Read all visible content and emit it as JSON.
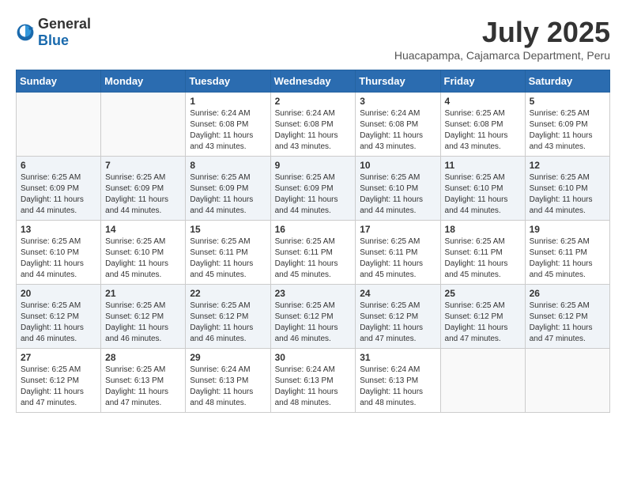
{
  "logo": {
    "general": "General",
    "blue": "Blue"
  },
  "title": {
    "month_year": "July 2025",
    "location": "Huacapampa, Cajamarca Department, Peru"
  },
  "weekdays": [
    "Sunday",
    "Monday",
    "Tuesday",
    "Wednesday",
    "Thursday",
    "Friday",
    "Saturday"
  ],
  "weeks": [
    [
      {
        "day": "",
        "info": ""
      },
      {
        "day": "",
        "info": ""
      },
      {
        "day": "1",
        "info": "Sunrise: 6:24 AM\nSunset: 6:08 PM\nDaylight: 11 hours and 43 minutes."
      },
      {
        "day": "2",
        "info": "Sunrise: 6:24 AM\nSunset: 6:08 PM\nDaylight: 11 hours and 43 minutes."
      },
      {
        "day": "3",
        "info": "Sunrise: 6:24 AM\nSunset: 6:08 PM\nDaylight: 11 hours and 43 minutes."
      },
      {
        "day": "4",
        "info": "Sunrise: 6:25 AM\nSunset: 6:08 PM\nDaylight: 11 hours and 43 minutes."
      },
      {
        "day": "5",
        "info": "Sunrise: 6:25 AM\nSunset: 6:09 PM\nDaylight: 11 hours and 43 minutes."
      }
    ],
    [
      {
        "day": "6",
        "info": "Sunrise: 6:25 AM\nSunset: 6:09 PM\nDaylight: 11 hours and 44 minutes."
      },
      {
        "day": "7",
        "info": "Sunrise: 6:25 AM\nSunset: 6:09 PM\nDaylight: 11 hours and 44 minutes."
      },
      {
        "day": "8",
        "info": "Sunrise: 6:25 AM\nSunset: 6:09 PM\nDaylight: 11 hours and 44 minutes."
      },
      {
        "day": "9",
        "info": "Sunrise: 6:25 AM\nSunset: 6:09 PM\nDaylight: 11 hours and 44 minutes."
      },
      {
        "day": "10",
        "info": "Sunrise: 6:25 AM\nSunset: 6:10 PM\nDaylight: 11 hours and 44 minutes."
      },
      {
        "day": "11",
        "info": "Sunrise: 6:25 AM\nSunset: 6:10 PM\nDaylight: 11 hours and 44 minutes."
      },
      {
        "day": "12",
        "info": "Sunrise: 6:25 AM\nSunset: 6:10 PM\nDaylight: 11 hours and 44 minutes."
      }
    ],
    [
      {
        "day": "13",
        "info": "Sunrise: 6:25 AM\nSunset: 6:10 PM\nDaylight: 11 hours and 44 minutes."
      },
      {
        "day": "14",
        "info": "Sunrise: 6:25 AM\nSunset: 6:10 PM\nDaylight: 11 hours and 45 minutes."
      },
      {
        "day": "15",
        "info": "Sunrise: 6:25 AM\nSunset: 6:11 PM\nDaylight: 11 hours and 45 minutes."
      },
      {
        "day": "16",
        "info": "Sunrise: 6:25 AM\nSunset: 6:11 PM\nDaylight: 11 hours and 45 minutes."
      },
      {
        "day": "17",
        "info": "Sunrise: 6:25 AM\nSunset: 6:11 PM\nDaylight: 11 hours and 45 minutes."
      },
      {
        "day": "18",
        "info": "Sunrise: 6:25 AM\nSunset: 6:11 PM\nDaylight: 11 hours and 45 minutes."
      },
      {
        "day": "19",
        "info": "Sunrise: 6:25 AM\nSunset: 6:11 PM\nDaylight: 11 hours and 45 minutes."
      }
    ],
    [
      {
        "day": "20",
        "info": "Sunrise: 6:25 AM\nSunset: 6:12 PM\nDaylight: 11 hours and 46 minutes."
      },
      {
        "day": "21",
        "info": "Sunrise: 6:25 AM\nSunset: 6:12 PM\nDaylight: 11 hours and 46 minutes."
      },
      {
        "day": "22",
        "info": "Sunrise: 6:25 AM\nSunset: 6:12 PM\nDaylight: 11 hours and 46 minutes."
      },
      {
        "day": "23",
        "info": "Sunrise: 6:25 AM\nSunset: 6:12 PM\nDaylight: 11 hours and 46 minutes."
      },
      {
        "day": "24",
        "info": "Sunrise: 6:25 AM\nSunset: 6:12 PM\nDaylight: 11 hours and 47 minutes."
      },
      {
        "day": "25",
        "info": "Sunrise: 6:25 AM\nSunset: 6:12 PM\nDaylight: 11 hours and 47 minutes."
      },
      {
        "day": "26",
        "info": "Sunrise: 6:25 AM\nSunset: 6:12 PM\nDaylight: 11 hours and 47 minutes."
      }
    ],
    [
      {
        "day": "27",
        "info": "Sunrise: 6:25 AM\nSunset: 6:12 PM\nDaylight: 11 hours and 47 minutes."
      },
      {
        "day": "28",
        "info": "Sunrise: 6:25 AM\nSunset: 6:13 PM\nDaylight: 11 hours and 47 minutes."
      },
      {
        "day": "29",
        "info": "Sunrise: 6:24 AM\nSunset: 6:13 PM\nDaylight: 11 hours and 48 minutes."
      },
      {
        "day": "30",
        "info": "Sunrise: 6:24 AM\nSunset: 6:13 PM\nDaylight: 11 hours and 48 minutes."
      },
      {
        "day": "31",
        "info": "Sunrise: 6:24 AM\nSunset: 6:13 PM\nDaylight: 11 hours and 48 minutes."
      },
      {
        "day": "",
        "info": ""
      },
      {
        "day": "",
        "info": ""
      }
    ]
  ]
}
